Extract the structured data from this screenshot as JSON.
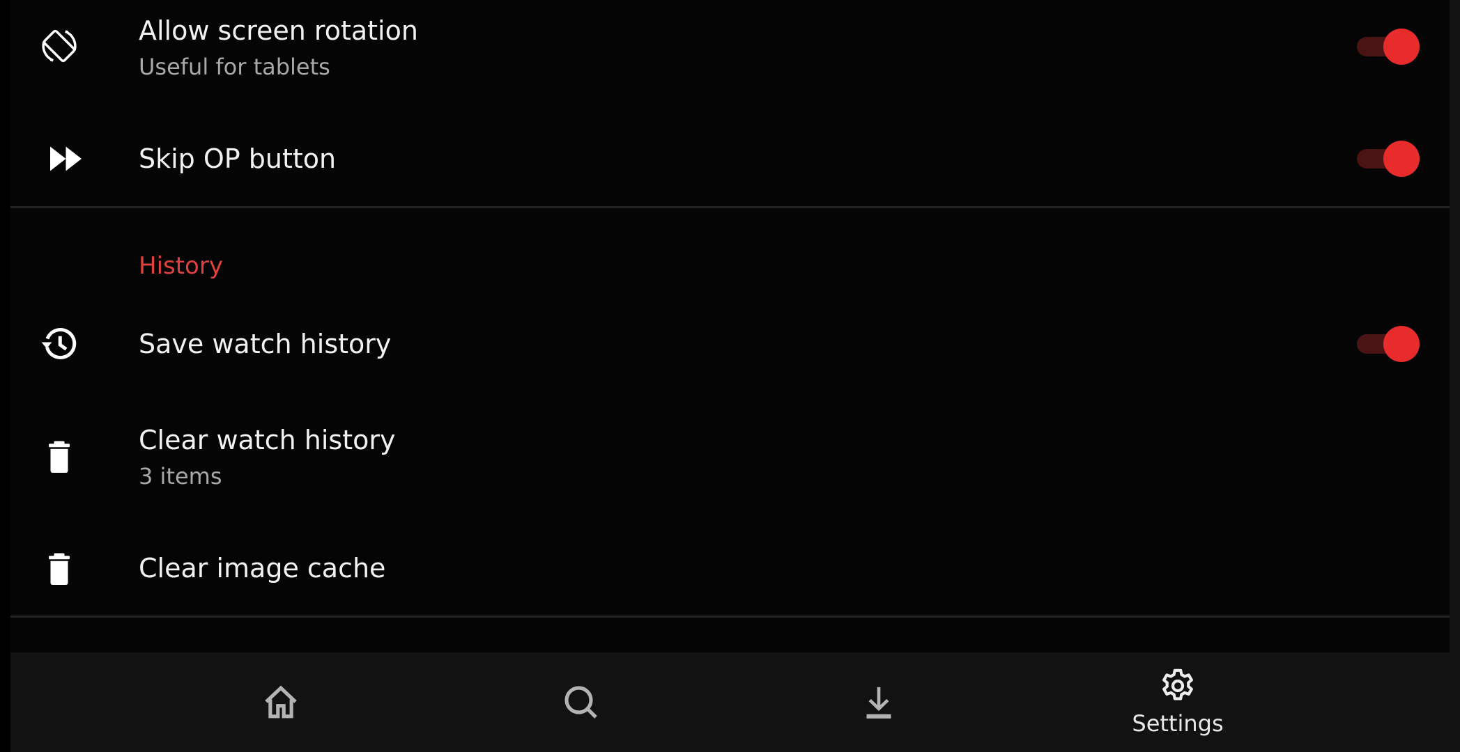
{
  "settings": {
    "general_rows": [
      {
        "title": "Allow screen rotation",
        "subtitle": "Useful for tablets",
        "icon": "screen-rotation-icon",
        "toggle_on": true
      },
      {
        "title": "Skip OP button",
        "icon": "fast-forward-icon",
        "toggle_on": true
      }
    ],
    "history_section": {
      "header": "History",
      "rows": [
        {
          "title": "Save watch history",
          "icon": "history-icon",
          "toggle_on": true
        },
        {
          "title": "Clear watch history",
          "subtitle": "3 items",
          "icon": "trash-icon"
        },
        {
          "title": "Clear image cache",
          "icon": "trash-icon"
        }
      ]
    }
  },
  "colors": {
    "accent": "#e82c2c",
    "accent_track": "#4a1414",
    "section_header": "#e04040",
    "background": "#050505",
    "nav_background": "#121212"
  },
  "bottom_nav": {
    "items": [
      {
        "name": "home",
        "icon": "home-icon",
        "label": "",
        "active": false
      },
      {
        "name": "search",
        "icon": "search-icon",
        "label": "",
        "active": false
      },
      {
        "name": "downloads",
        "icon": "download-icon",
        "label": "",
        "active": false
      },
      {
        "name": "settings",
        "icon": "gear-icon",
        "label": "Settings",
        "active": true
      }
    ]
  }
}
